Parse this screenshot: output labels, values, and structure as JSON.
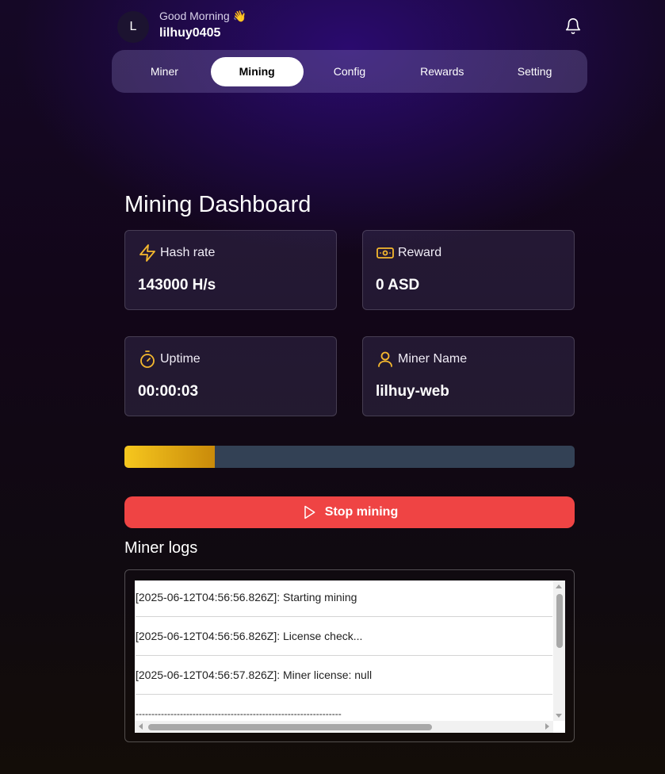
{
  "header": {
    "avatar_initial": "L",
    "greeting": "Good Morning 👋",
    "username": "lilhuy0405",
    "notification_icon": "bell-icon"
  },
  "tabs": [
    {
      "label": "Miner",
      "active": false
    },
    {
      "label": "Mining",
      "active": true
    },
    {
      "label": "Config",
      "active": false
    },
    {
      "label": "Rewards",
      "active": false
    },
    {
      "label": "Setting",
      "active": false
    }
  ],
  "dashboard": {
    "title": "Mining Dashboard",
    "cards": {
      "hash_rate": {
        "label": "Hash rate",
        "value": "143000 H/s",
        "icon": "lightning-icon"
      },
      "reward": {
        "label": "Reward",
        "value": "0 ASD",
        "icon": "banknote-icon"
      },
      "uptime": {
        "label": "Uptime",
        "value": "00:00:03",
        "icon": "timer-icon"
      },
      "miner_name": {
        "label": "Miner Name",
        "value": "lilhuy-web",
        "icon": "user-icon"
      }
    },
    "progress_fraction": 0.2,
    "stop_button_label": "Stop mining",
    "stop_button_icon": "play-icon"
  },
  "logs": {
    "title": "Miner logs",
    "lines": [
      "[2025-06-12T04:56:56.826Z]: Starting mining",
      "[2025-06-12T04:56:56.826Z]: License check...",
      "[2025-06-12T04:56:57.826Z]: Miner license: null",
      "-----------------------------------------------------------------"
    ]
  },
  "colors": {
    "accent_icon": "#f5b82e",
    "stop_button": "#ef4444",
    "progress_fill": "#f6c71e",
    "progress_track": "#334155"
  }
}
